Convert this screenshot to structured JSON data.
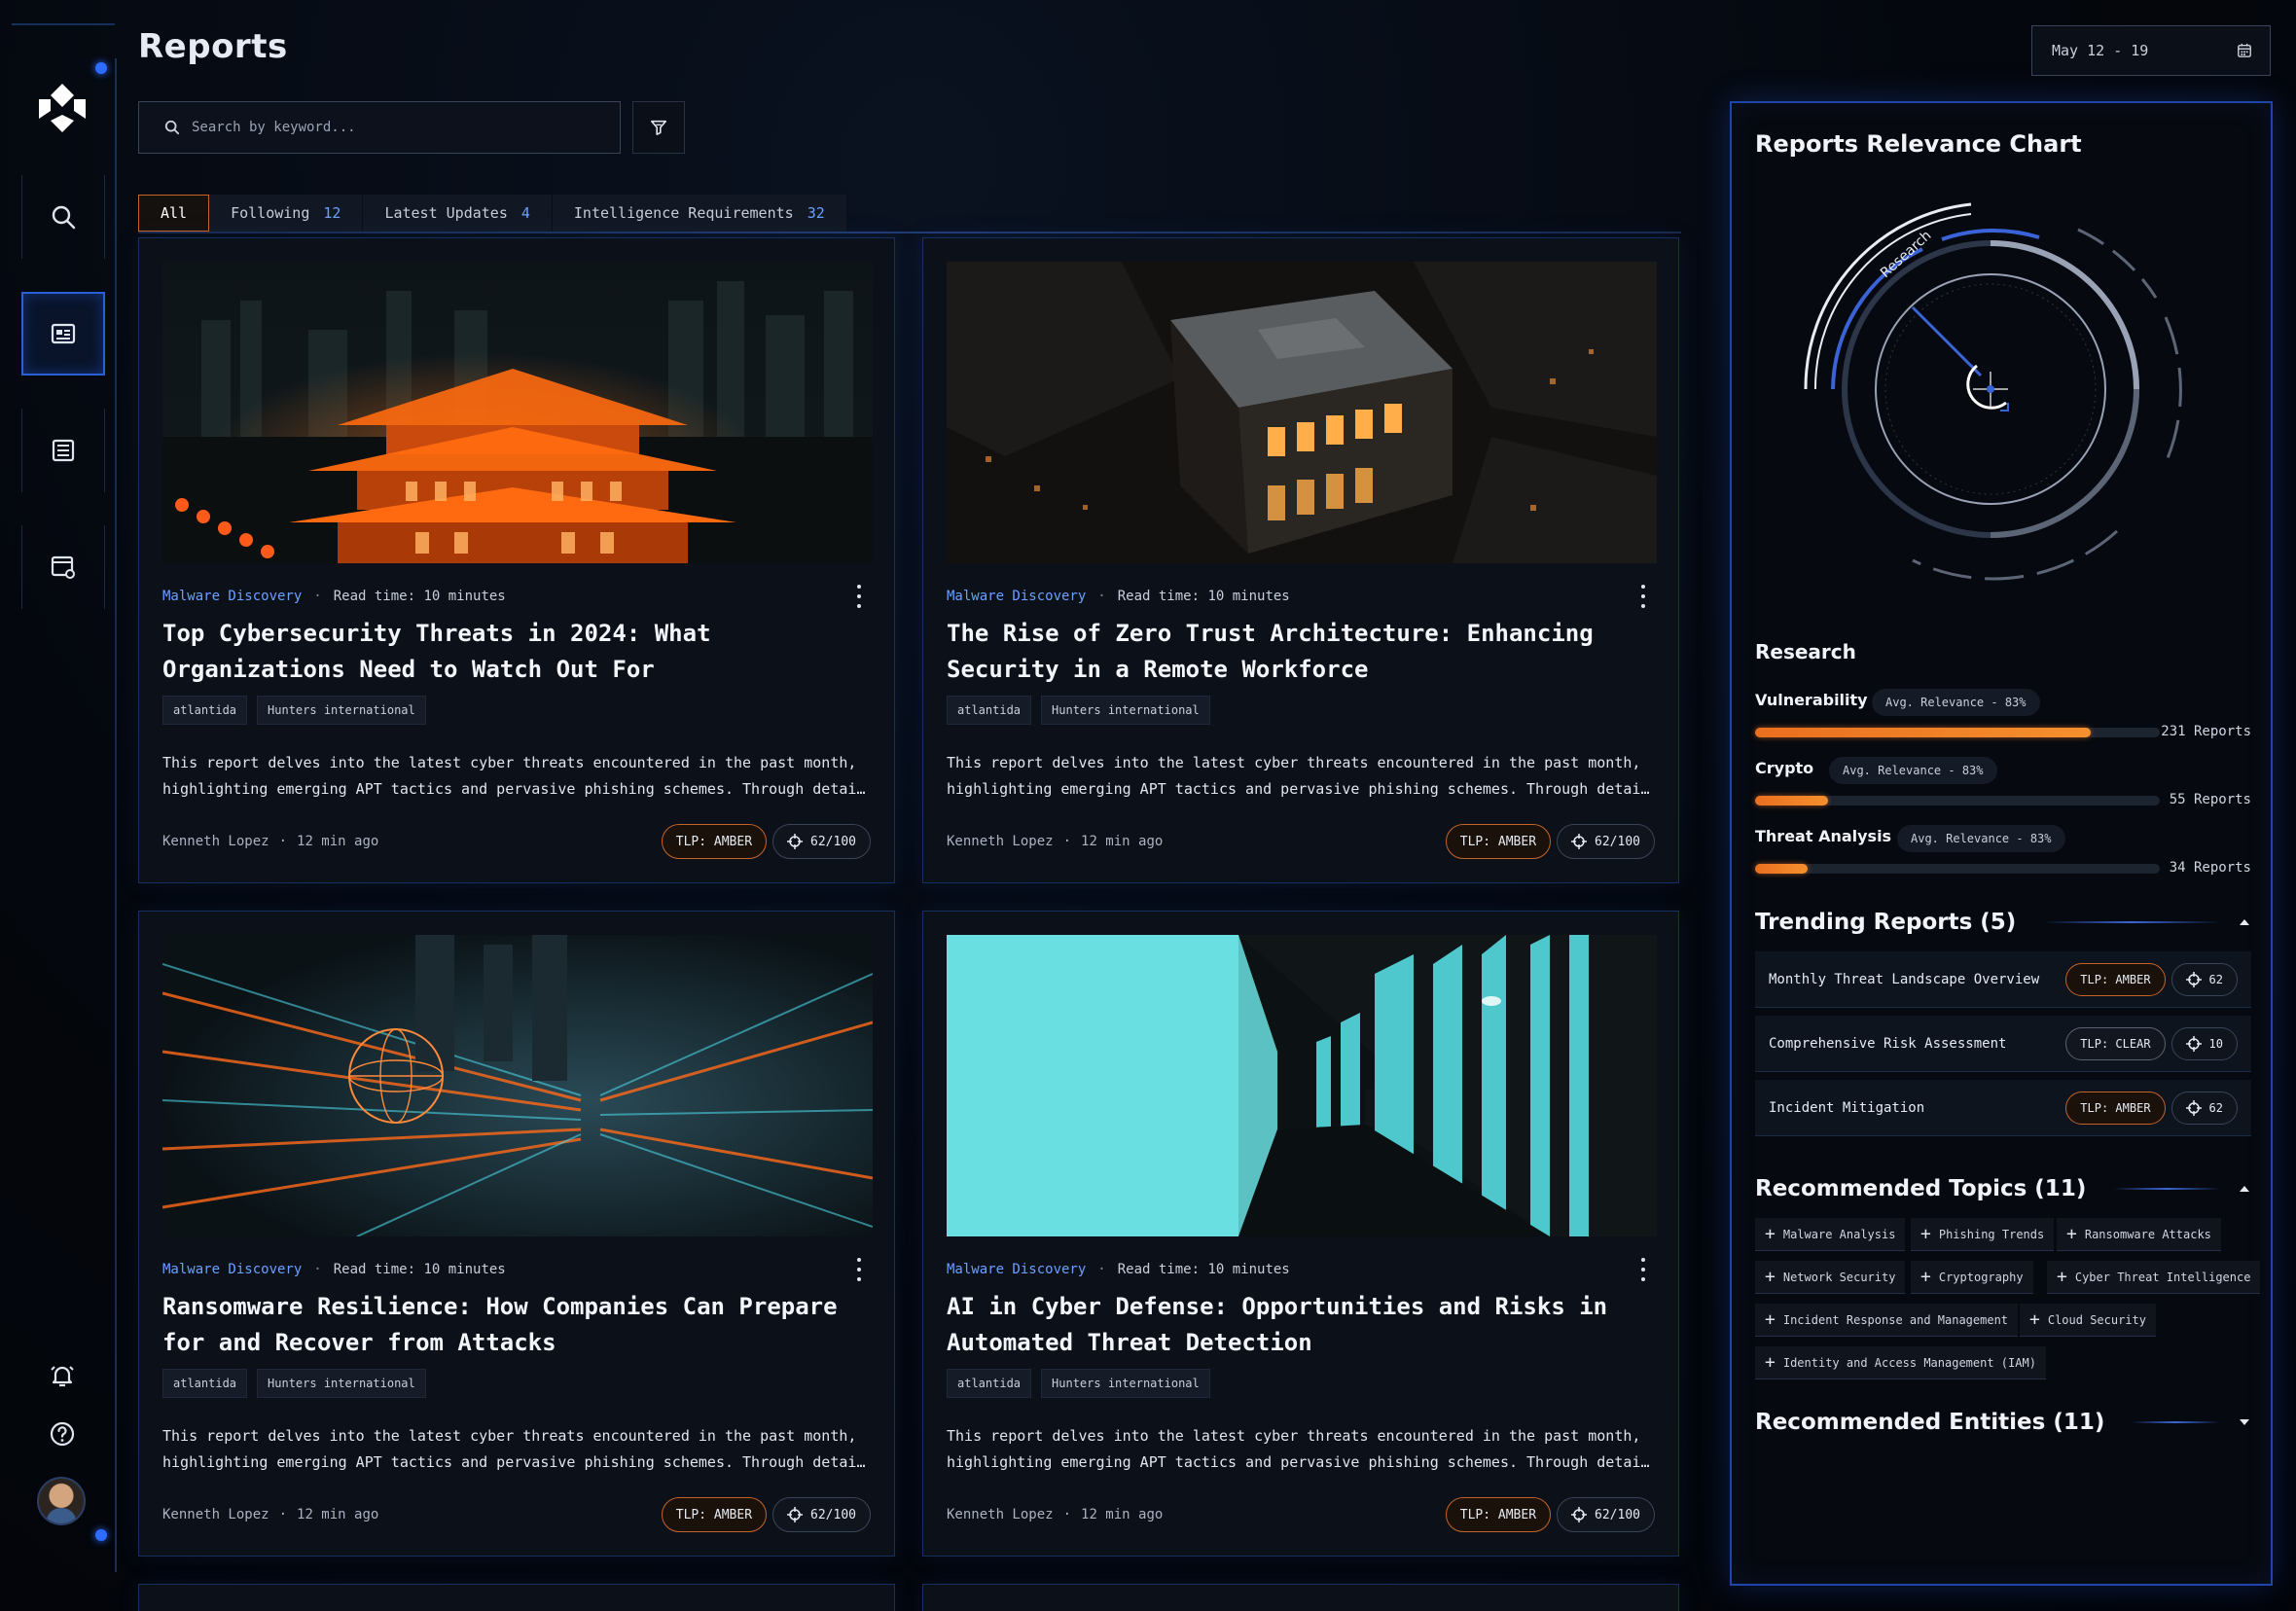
{
  "page": {
    "title": "Reports",
    "accent": "#2e6cff",
    "orange": "#e96f1f"
  },
  "search": {
    "placeholder": "Search by keyword..."
  },
  "date_range": "May 12 - 19",
  "tabs": [
    {
      "label": "All",
      "count": ""
    },
    {
      "label": "Following",
      "count": "12"
    },
    {
      "label": "Latest Updates",
      "count": "4"
    },
    {
      "label": "Intelligence Requirements",
      "count": "32"
    }
  ],
  "sidebar": {
    "items": [
      "search-icon",
      "reports-icon",
      "news-icon",
      "settings-window-icon"
    ],
    "bottom": [
      "bell-icon",
      "help-icon",
      "avatar"
    ]
  },
  "cards": [
    {
      "category": "Malware Discovery",
      "read_time": "Read time: 10 minutes",
      "title": "Top Cybersecurity Threats in 2024: What Organizations Need to Watch Out For",
      "tags": [
        "atlantida",
        "Hunters international"
      ],
      "desc_line1": "This report delves into the latest cyber threats encountered in the past month,",
      "desc_line2": "highlighting emerging APT tactics and pervasive phishing schemes. Through detailed analysis",
      "author": "Kenneth Lopez",
      "time": "12 min ago",
      "tlp": "TLP: AMBER",
      "score": "62/100"
    },
    {
      "category": "Malware Discovery",
      "read_time": "Read time: 10 minutes",
      "title": "The Rise of Zero Trust Architecture: Enhancing Security in a Remote Workforce",
      "tags": [
        "atlantida",
        "Hunters international"
      ],
      "desc_line1": "This report delves into the latest cyber threats encountered in the past month,",
      "desc_line2": "highlighting emerging APT tactics and pervasive phishing schemes. Through detailed analysis",
      "author": "Kenneth Lopez",
      "time": "12 min ago",
      "tlp": "TLP: AMBER",
      "score": "62/100"
    },
    {
      "category": "Malware Discovery",
      "read_time": "Read time: 10 minutes",
      "title": "Ransomware Resilience: How Companies Can Prepare for and Recover from Attacks",
      "tags": [
        "atlantida",
        "Hunters international"
      ],
      "desc_line1": "This report delves into the latest cyber threats encountered in the past month,",
      "desc_line2": "highlighting emerging APT tactics and pervasive phishing schemes. Through detailed analysis",
      "author": "Kenneth Lopez",
      "time": "12 min ago",
      "tlp": "TLP: AMBER",
      "score": "62/100"
    },
    {
      "category": "Malware Discovery",
      "read_time": "Read time: 10 minutes",
      "title": "AI in Cyber Defense: Opportunities and Risks in Automated Threat Detection",
      "tags": [
        "atlantida",
        "Hunters international"
      ],
      "desc_line1": "This report delves into the latest cyber threats encountered in the past month,",
      "desc_line2": "highlighting emerging APT tactics and pervasive phishing schemes. Through detailed analysis",
      "author": "Kenneth Lopez",
      "time": "12 min ago",
      "tlp": "TLP: AMBER",
      "score": "62/100"
    }
  ],
  "right_panel": {
    "chart_title": "Reports Relevance Chart",
    "radar_label": "Research",
    "research_title": "Research",
    "relevance": [
      {
        "name": "Vulnerability",
        "avg": "Avg. Relevance - 83%",
        "fill": 0.83,
        "count": "231 Reports"
      },
      {
        "name": "Crypto",
        "avg": "Avg. Relevance - 83%",
        "fill": 0.18,
        "count": "55 Reports"
      },
      {
        "name": "Threat Analysis",
        "avg": "Avg. Relevance - 83%",
        "fill": 0.13,
        "count": "34 Reports"
      }
    ],
    "trending_title": "Trending Reports (5)",
    "trending": [
      {
        "name": "Monthly Threat Landscape Overview",
        "tlp": "TLP: AMBER",
        "score": "62"
      },
      {
        "name": "Comprehensive Risk Assessment",
        "tlp": "TLP: CLEAR",
        "score": "10"
      },
      {
        "name": "Incident Mitigation",
        "tlp": "TLP: AMBER",
        "score": "62"
      }
    ],
    "topics_title": "Recommended Topics (11)",
    "topics": [
      "Malware Analysis",
      "Phishing Trends",
      "Ransomware Attacks",
      "Network Security",
      "Cryptography",
      "Cyber Threat Intelligence",
      "Incident Response and Management",
      "Cloud Security",
      "Identity and Access Management (IAM)"
    ],
    "entities_title": "Recommended Entities (11)"
  }
}
